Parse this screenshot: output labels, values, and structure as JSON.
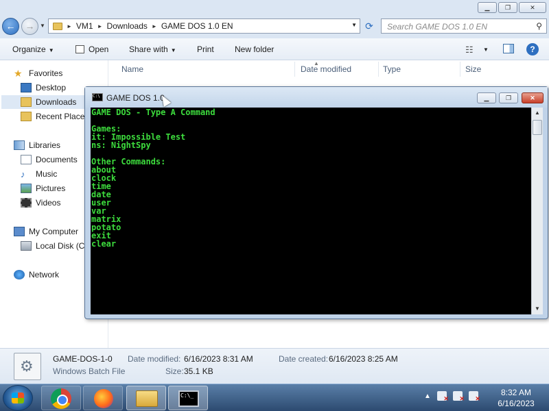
{
  "explorer": {
    "address": {
      "crumbs": [
        "VM1",
        "Downloads",
        "GAME DOS 1.0 EN"
      ]
    },
    "search": {
      "placeholder": "Search GAME DOS 1.0 EN"
    },
    "toolbar": {
      "organize": "Organize",
      "open": "Open",
      "share_with": "Share with",
      "print": "Print",
      "new_folder": "New folder"
    },
    "sidebar": {
      "favorites": "Favorites",
      "desktop": "Desktop",
      "downloads": "Downloads",
      "recent": "Recent Places",
      "libraries": "Libraries",
      "documents": "Documents",
      "music": "Music",
      "pictures": "Pictures",
      "videos": "Videos",
      "computer": "My Computer",
      "local_disk": "Local Disk (C:",
      "network": "Network"
    },
    "columns": {
      "name": "Name",
      "date_modified": "Date modified",
      "type": "Type",
      "size": "Size"
    },
    "details": {
      "filename": "GAME-DOS-1-0",
      "filetype": "Windows Batch File",
      "date_modified_label": "Date modified:",
      "date_modified": "6/16/2023 8:31 AM",
      "size_label": "Size:",
      "size": "35.1 KB",
      "date_created_label": "Date created:",
      "date_created": "6/16/2023 8:25 AM"
    }
  },
  "cmd": {
    "title": "GAME DOS 1.0",
    "lines": [
      "GAME DOS - Type A Command",
      "",
      "Games:",
      "it: Impossible Test",
      "ns: NightSpy",
      "",
      "Other Commands:",
      "about",
      "clock",
      "time",
      "date",
      "user",
      "var",
      "matrix",
      "potato",
      "exit",
      "clear"
    ],
    "text_color": "#3ddc3d"
  },
  "taskbar": {
    "time": "8:32 AM",
    "date": "6/16/2023"
  }
}
